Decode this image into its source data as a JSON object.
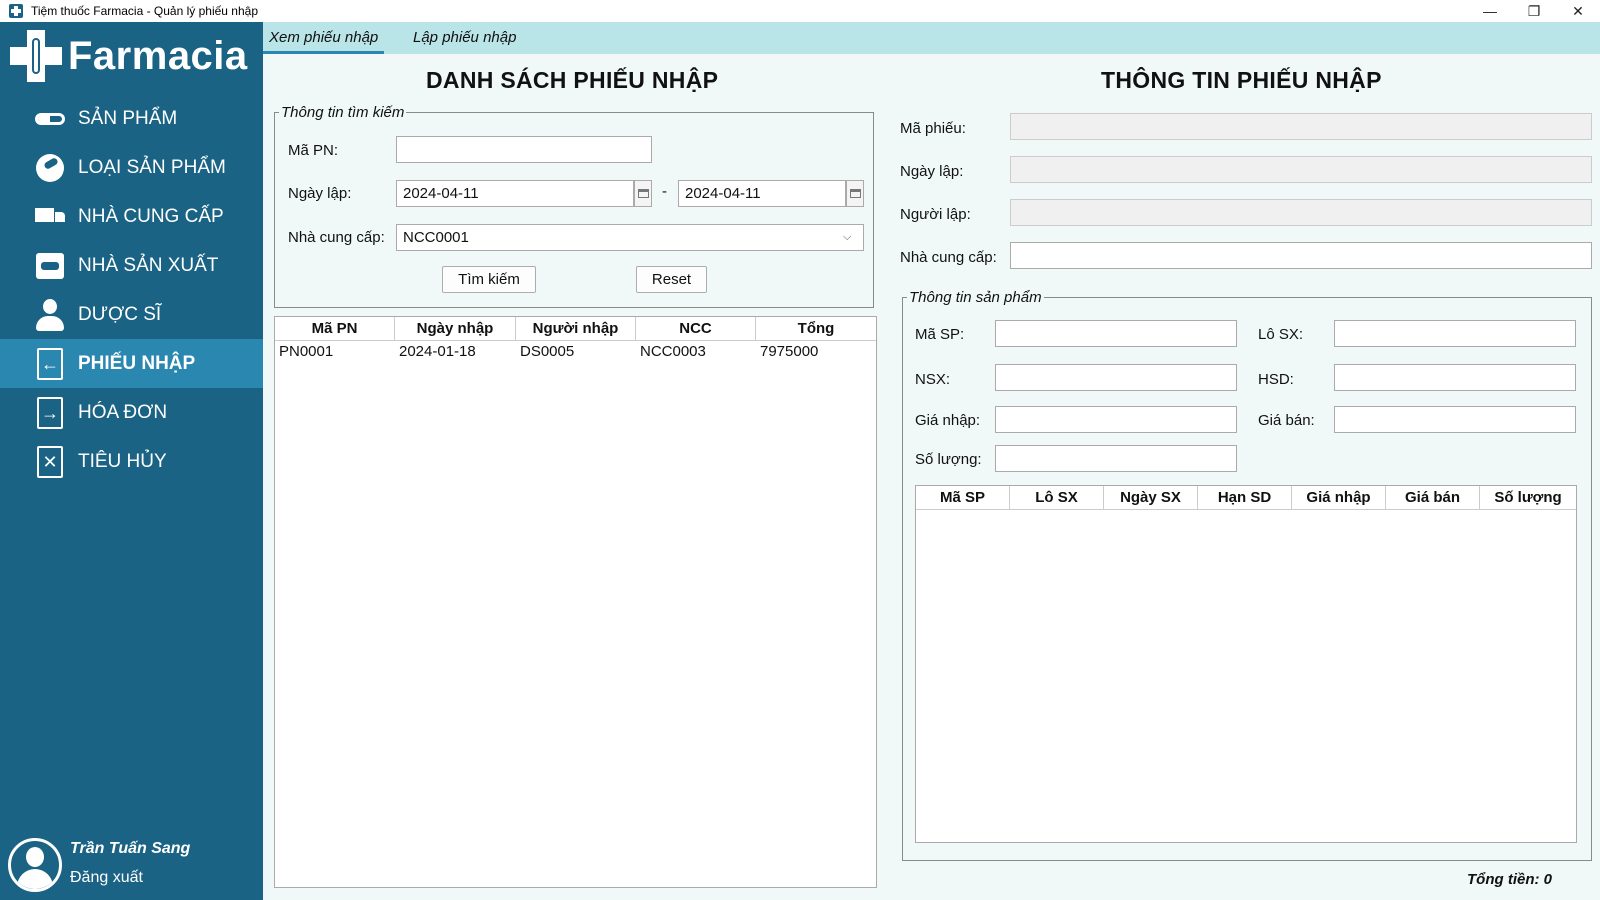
{
  "window": {
    "title": "Tiệm thuốc Farmacia - Quản lý phiếu nhập",
    "minimize": "—",
    "restore": "❐",
    "close": "✕"
  },
  "sidebar": {
    "brand": "Farmacia",
    "items": [
      {
        "label": "SẢN PHẨM",
        "icon": "pill-icon"
      },
      {
        "label": "LOẠI SẢN PHẨM",
        "icon": "pills-icon"
      },
      {
        "label": "NHÀ CUNG CẤP",
        "icon": "truck-icon"
      },
      {
        "label": "NHÀ SẢN XUẤT",
        "icon": "factory-box-icon"
      },
      {
        "label": "DƯỢC SĨ",
        "icon": "user-icon"
      },
      {
        "label": "PHIẾU NHẬP",
        "icon": "import-doc-icon",
        "active": true
      },
      {
        "label": "HÓA ĐƠN",
        "icon": "invoice-doc-icon"
      },
      {
        "label": "TIÊU HỦY",
        "icon": "destroy-doc-icon"
      }
    ],
    "user_name": "Trần Tuấn Sang",
    "logout": "Đăng xuất"
  },
  "tabs": {
    "view": "Xem phiếu nhập",
    "create": "Lập phiếu nhập"
  },
  "left": {
    "title": "DANH SÁCH PHIẾU NHẬP",
    "search_group": "Thông tin tìm kiếm",
    "ma_pn_label": "Mã PN:",
    "ma_pn_value": "",
    "ngay_lap_label": "Ngày lập:",
    "date_from": "2024-04-11",
    "date_sep": "-",
    "date_to": "2024-04-11",
    "ncc_label": "Nhà cung cấp:",
    "ncc_value": "NCC0001",
    "search_button": "Tìm kiếm",
    "reset_button": "Reset",
    "table": {
      "headers": [
        "Mã PN",
        "Ngày nhập",
        "Người nhập",
        "NCC",
        "Tổng"
      ],
      "rows": [
        [
          "PN0001",
          "2024-01-18",
          "DS0005",
          "NCC0003",
          "7975000"
        ]
      ]
    }
  },
  "right": {
    "title": "THÔNG TIN PHIẾU NHẬP",
    "ma_phieu_label": "Mã phiếu:",
    "ngay_lap_label": "Ngày lập:",
    "nguoi_lap_label": "Người lập:",
    "ncc_label": "Nhà cung cấp:",
    "product_group": "Thông tin sản phẩm",
    "ma_sp_label": "Mã SP:",
    "lo_sx_label": "Lô SX:",
    "nsx_label": "NSX:",
    "hsd_label": "HSD:",
    "gia_nhap_label": "Giá nhập:",
    "gia_ban_label": "Giá bán:",
    "so_luong_label": "Số lượng:",
    "table": {
      "headers": [
        "Mã SP",
        "Lô SX",
        "Ngày SX",
        "Hạn SD",
        "Giá nhập",
        "Giá bán",
        "Số lượng"
      ]
    },
    "total": "Tổng tiền: 0"
  }
}
